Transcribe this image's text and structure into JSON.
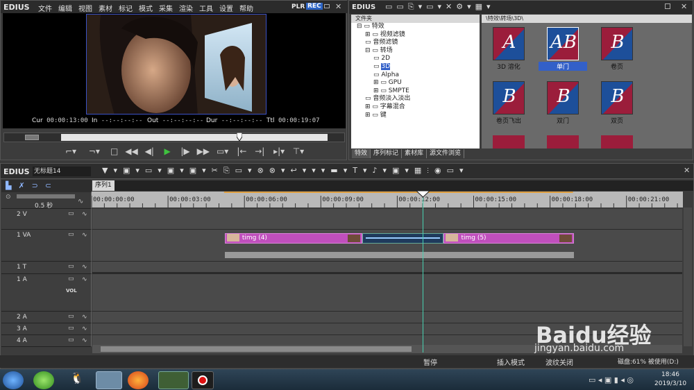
{
  "player": {
    "brand": "EDIUS",
    "menu": [
      "文件",
      "编辑",
      "视图",
      "素材",
      "标记",
      "模式",
      "采集",
      "渲染",
      "工具",
      "设置",
      "帮助"
    ],
    "plr": "PLR",
    "rec": "REC",
    "cur_label": "Cur",
    "cur": "00:00:13:00",
    "in_label": "In",
    "in": "--:--:--:--",
    "out_label": "Out",
    "out": "--:--:--:--",
    "dur_label": "Dur",
    "dur": "--:--:--:--",
    "ttl_label": "Ttl",
    "ttl": "00:00:19:07",
    "scrub_position": 0.67
  },
  "effects": {
    "brand": "EDIUS",
    "folder_label": "文件夹",
    "path": "\\特效\\转场\\3D\\",
    "tree": [
      {
        "label": "特效",
        "level": 0,
        "sign": "⊟"
      },
      {
        "label": "视频滤镜",
        "level": 1,
        "sign": "⊞"
      },
      {
        "label": "音频滤镜",
        "level": 1,
        "sign": ""
      },
      {
        "label": "转场",
        "level": 1,
        "sign": "⊟"
      },
      {
        "label": "2D",
        "level": 2,
        "sign": ""
      },
      {
        "label": "3D",
        "level": 2,
        "sign": "",
        "selected": true
      },
      {
        "label": "Alpha",
        "level": 2,
        "sign": ""
      },
      {
        "label": "GPU",
        "level": 2,
        "sign": "⊞"
      },
      {
        "label": "SMPTE",
        "level": 2,
        "sign": "⊞"
      },
      {
        "label": "音频淡入淡出",
        "level": 1,
        "sign": ""
      },
      {
        "label": "字幕混合",
        "level": 1,
        "sign": "⊞"
      },
      {
        "label": "键",
        "level": 1,
        "sign": "⊞"
      }
    ],
    "thumbs": [
      {
        "label": "3D 溶化",
        "letter": "A"
      },
      {
        "label": "单门",
        "letter": "AB",
        "selected": true
      },
      {
        "label": "卷页",
        "letter": "B"
      },
      {
        "label": "卷页飞出",
        "letter": "B"
      },
      {
        "label": "双门",
        "letter": "B"
      },
      {
        "label": "双页",
        "letter": "B"
      }
    ],
    "tabs": [
      "特效",
      "序列标记",
      "素材库",
      "源文件浏览"
    ]
  },
  "timeline": {
    "brand": "EDIUS",
    "project": "无标题14",
    "sequence_tab": "序列1",
    "zoom": "0.5 秒",
    "ruler_labels": [
      "00:00:00:00",
      "00:00:03:00",
      "00:00:06:00",
      "00:00:09:00",
      "00:00:12:00",
      "00:00:15:00",
      "00:00:18:00",
      "00:00:21:00"
    ],
    "tracks": [
      {
        "label": "2 V",
        "height": 30
      },
      {
        "label": "1 VA",
        "height": 46
      },
      {
        "label": "1 T",
        "height": 18
      },
      {
        "label": "1 A",
        "height": 54,
        "vol": "VOL"
      },
      {
        "label": "2 A",
        "height": 17
      },
      {
        "label": "3 A",
        "height": 17
      },
      {
        "label": "4 A",
        "height": 17
      }
    ],
    "clips": [
      {
        "label": "timg (4)",
        "start_sec": 5.2,
        "end_sec": 10.6
      },
      {
        "label": "timg (5)",
        "start_sec": 13.8,
        "end_sec": 18.9
      }
    ],
    "transition": {
      "start_sec": 10.6,
      "end_sec": 13.8
    },
    "playhead_sec": 13.0
  },
  "status": {
    "state": "暂停",
    "mode": "插入模式",
    "ripple": "波纹关闭",
    "disk": "磁盘:61% 被使用(D:)"
  },
  "taskbar": {
    "time": "18:46",
    "date": "2019/3/10"
  },
  "watermark": "Baidu经验",
  "watermark_url": "jingyan.baidu.com"
}
